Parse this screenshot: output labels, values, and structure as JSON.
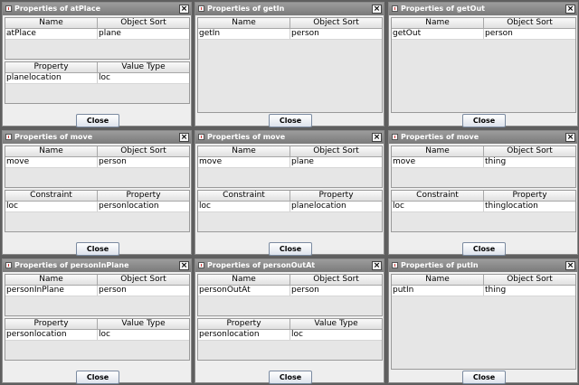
{
  "windows": [
    {
      "title": "Properties of atPlace",
      "tables": [
        {
          "headers": [
            "Name",
            "Object Sort"
          ],
          "rows": [
            [
              "atPlace",
              "plane"
            ]
          ]
        },
        {
          "headers": [
            "Property",
            "Value Type"
          ],
          "rows": [
            [
              "planelocation",
              "loc"
            ]
          ]
        }
      ],
      "button": "Close"
    },
    {
      "title": "Properties of getIn",
      "tables": [
        {
          "headers": [
            "Name",
            "Object Sort"
          ],
          "rows": [
            [
              "getIn",
              "person"
            ]
          ]
        }
      ],
      "button": "Close"
    },
    {
      "title": "Properties of getOut",
      "tables": [
        {
          "headers": [
            "Name",
            "Object Sort"
          ],
          "rows": [
            [
              "getOut",
              "person"
            ]
          ]
        }
      ],
      "button": "Close"
    },
    {
      "title": "Properties of move",
      "tables": [
        {
          "headers": [
            "Name",
            "Object Sort"
          ],
          "rows": [
            [
              "move",
              "person"
            ]
          ]
        },
        {
          "headers": [
            "Constraint",
            "Property"
          ],
          "rows": [
            [
              "loc",
              "personlocation"
            ]
          ]
        }
      ],
      "button": "Close"
    },
    {
      "title": "Properties of move",
      "tables": [
        {
          "headers": [
            "Name",
            "Object Sort"
          ],
          "rows": [
            [
              "move",
              "plane"
            ]
          ]
        },
        {
          "headers": [
            "Constraint",
            "Property"
          ],
          "rows": [
            [
              "loc",
              "planelocation"
            ]
          ]
        }
      ],
      "button": "Close"
    },
    {
      "title": "Properties of move",
      "tables": [
        {
          "headers": [
            "Name",
            "Object Sort"
          ],
          "rows": [
            [
              "move",
              "thing"
            ]
          ]
        },
        {
          "headers": [
            "Constraint",
            "Property"
          ],
          "rows": [
            [
              "loc",
              "thinglocation"
            ]
          ]
        }
      ],
      "button": "Close"
    },
    {
      "title": "Properties of personInPlane",
      "tables": [
        {
          "headers": [
            "Name",
            "Object Sort"
          ],
          "rows": [
            [
              "personInPlane",
              "person"
            ]
          ]
        },
        {
          "headers": [
            "Property",
            "Value Type"
          ],
          "rows": [
            [
              "personlocation",
              "loc"
            ]
          ]
        }
      ],
      "button": "Close"
    },
    {
      "title": "Properties of personOutAt",
      "tables": [
        {
          "headers": [
            "Name",
            "Object Sort"
          ],
          "rows": [
            [
              "personOutAt",
              "person"
            ]
          ]
        },
        {
          "headers": [
            "Property",
            "Value Type"
          ],
          "rows": [
            [
              "personlocation",
              "loc"
            ]
          ]
        }
      ],
      "button": "Close"
    },
    {
      "title": "Properties of putIn",
      "tables": [
        {
          "headers": [
            "Name",
            "Object Sort"
          ],
          "rows": [
            [
              "putIn",
              "thing"
            ]
          ]
        }
      ],
      "button": "Close"
    }
  ]
}
